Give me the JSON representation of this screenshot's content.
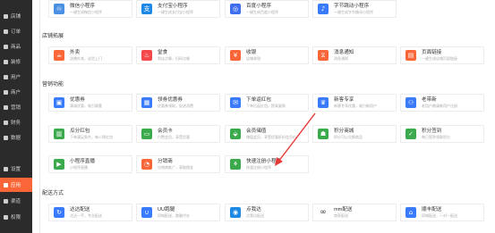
{
  "sidebar": {
    "items": [
      {
        "label": "店铺",
        "icon": "shop-icon",
        "active": false
      },
      {
        "label": "订单",
        "icon": "order-icon",
        "active": false
      },
      {
        "label": "商品",
        "icon": "goods-icon",
        "active": false
      },
      {
        "label": "装修",
        "icon": "decorate-icon",
        "active": false
      },
      {
        "label": "用户",
        "icon": "user-icon",
        "active": false
      },
      {
        "label": "商户",
        "icon": "merchant-icon",
        "active": false
      },
      {
        "label": "营销",
        "icon": "marketing-icon",
        "active": false
      },
      {
        "label": "财务",
        "icon": "finance-icon",
        "active": false
      },
      {
        "label": "数据",
        "icon": "data-icon",
        "active": false
      },
      {
        "label": "设置",
        "icon": "settings-icon",
        "active": false
      },
      {
        "label": "应用",
        "icon": "apps-icon",
        "active": true
      },
      {
        "label": "渠道",
        "icon": "channel-icon",
        "active": false
      },
      {
        "label": "权限",
        "icon": "permission-icon",
        "active": false
      }
    ]
  },
  "top_row": [
    {
      "title": "微信小程序",
      "sub": "一键生成微信小程序",
      "color": "#4a90e2",
      "icon": "wechat-miniprogram-icon",
      "glyph": "♾"
    },
    {
      "title": "支付宝小程序",
      "sub": "一键生成支付宝小程序",
      "color": "#1e88e5",
      "icon": "alipay-icon",
      "glyph": "支"
    },
    {
      "title": "百度小程序",
      "sub": "一键生成百度小程序",
      "color": "#3f6ef0",
      "icon": "baidu-icon",
      "glyph": "◎"
    },
    {
      "title": "字节跳动小程序",
      "sub": "一键生成字节跳动小程序",
      "color": "#3a7bfd",
      "icon": "bytedance-icon",
      "glyph": "♪"
    }
  ],
  "sections": [
    {
      "name": "店铺拓展",
      "cards": [
        {
          "title": "外卖",
          "sub": "店铺外卖，送货上门",
          "color": "#fb6638",
          "icon": "takeout-icon",
          "glyph": "☕"
        },
        {
          "title": "堂食",
          "sub": "到店点餐，扫码点餐",
          "color": "#f5484a",
          "icon": "dine-in-icon",
          "glyph": "♨"
        },
        {
          "title": "收银",
          "sub": "店铺收银",
          "color": "#fb6638",
          "icon": "cashier-icon",
          "glyph": "¥"
        },
        {
          "title": "消息通知",
          "sub": "消息通知",
          "color": "#fb6638",
          "icon": "notification-icon",
          "glyph": "⧖"
        },
        {
          "title": "页面链接",
          "sub": "一键生成店铺页面链接",
          "color": "#fb6638",
          "icon": "page-link-icon",
          "glyph": "▤"
        }
      ]
    },
    {
      "name": "营销功能",
      "cards": [
        {
          "title": "优惠券",
          "sub": "满减优惠，吸引顾客",
          "color": "#3a7bfd",
          "icon": "coupon-icon",
          "glyph": "▣"
        },
        {
          "title": "领劵优惠券",
          "sub": "优惠券领取，促进消费",
          "color": "#3a7bfd",
          "icon": "collect-coupon-icon",
          "glyph": "▦"
        },
        {
          "title": "下单返红包",
          "sub": "下单后返红包，提高复购",
          "color": "#3a7bfd",
          "icon": "order-redpacket-icon",
          "glyph": "✉"
        },
        {
          "title": "新客专享",
          "sub": "新客专享优惠，吸引新用户",
          "color": "#3a7bfd",
          "icon": "new-customer-icon",
          "glyph": "♛"
        },
        {
          "title": "老带新",
          "sub": "老用户邀请新用户注册",
          "color": "#3a7bfd",
          "icon": "referral-icon",
          "glyph": "⚇"
        },
        {
          "title": "瓜分红包",
          "sub": "下单满足条件，每人得红包",
          "color": "#3aaa4c",
          "icon": "split-redpacket-icon",
          "glyph": "▥"
        },
        {
          "title": "会员卡",
          "sub": "付费会员，享受优惠",
          "color": "#3aaa4c",
          "icon": "member-card-icon",
          "glyph": "▭"
        },
        {
          "title": "会员储值",
          "sub": "储值会员，享受优惠折扣会员价",
          "color": "#3aaa4c",
          "icon": "member-deposit-icon",
          "glyph": "⬙"
        },
        {
          "title": "积分商城",
          "sub": "积分可以兑换商品",
          "color": "#3aaa4c",
          "icon": "points-mall-icon",
          "glyph": "☗"
        },
        {
          "title": "积分签到",
          "sub": "每日签到领取积分",
          "color": "#3aaa4c",
          "icon": "points-checkin-icon",
          "glyph": "✓"
        },
        {
          "title": "小程序直播",
          "sub": "小程序直播",
          "color": "#3aaa4c",
          "icon": "live-icon",
          "glyph": "▶"
        },
        {
          "title": "分销商",
          "sub": "分销商推广，获取佣金",
          "color": "#fb6638",
          "icon": "distributor-icon",
          "glyph": "◔"
        },
        {
          "title": "快速注册小程序",
          "sub": "快速注册小程序",
          "color": "#3aaa4c",
          "icon": "quick-register-icon",
          "glyph": "⚘"
        }
      ]
    },
    {
      "name": "配送方式",
      "cards": [
        {
          "title": "达达配送",
          "sub": "达达一手，专业配送",
          "color": "#3a7bfd",
          "icon": "dada-icon",
          "glyph": "↻"
        },
        {
          "title": "UU跑腿",
          "sub": "同城配送，跑腿代办",
          "color": "#3a7bfd",
          "icon": "uu-icon",
          "glyph": "∪"
        },
        {
          "title": "点我达",
          "sub": "点我达配送",
          "color": "#1e88e5",
          "icon": "dianwoda-icon",
          "glyph": "◉"
        },
        {
          "title": "mm配送",
          "sub": "商家配送",
          "color": "#ffffff",
          "icon": "mm-delivery-icon",
          "glyph": "∞"
        },
        {
          "title": "顺丰配送",
          "sub": "同城配送，一对一配送",
          "color": "#3a7bfd",
          "icon": "sf-express-icon",
          "glyph": "⌂"
        }
      ]
    }
  ],
  "annotation": {
    "color": "#e53935"
  }
}
